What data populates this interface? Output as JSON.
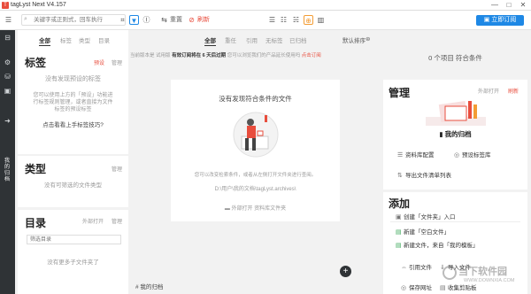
{
  "app": {
    "title": "tagLyst Next V4.157",
    "logo": "T"
  },
  "window_controls": [
    "—",
    "□",
    "✕"
  ],
  "toolbar": {
    "search_placeholder": "关键字或正则式，回车执行",
    "reset_label": "重置",
    "refresh_label": "刷新",
    "subscribe_label": "立即订阅"
  },
  "rail": {
    "vertical_text": "我的归档"
  },
  "tags_panel": {
    "tabs": [
      "全部",
      "标签",
      "类型",
      "目录"
    ],
    "title": "标签",
    "preset_label": "预设",
    "manage_label": "管理",
    "empty_title": "没有发现预设的标签",
    "desc_lines": [
      "您可以使用上方的「预设」功能进",
      "行标签规则管理，或者直接为文件",
      "标签的预设标签"
    ],
    "help_link": "点击看看上手标签技巧?"
  },
  "type_panel": {
    "title": "类型",
    "manage_label": "管理",
    "empty": "没有可筛选的文件类型"
  },
  "dir_panel": {
    "title": "目录",
    "open_label": "外部打开",
    "manage_label": "管理",
    "filter_placeholder": "筛选目录",
    "empty": "没有更多子文件夹了"
  },
  "center": {
    "tabs": [
      "全部",
      "重任",
      "引用",
      "无标签",
      "已归档"
    ],
    "sort_label": "默认排序",
    "notice_prefix": "当前版本是 试用版",
    "notice_bold": "有效订阅将在 6 天后过期",
    "notice_suffix": "您可以浏览我们的产品延长使用吗",
    "notice_link": "点击订阅",
    "empty_title": "没有发现符合条件的文件",
    "desc_lines": [
      "您可以改变检索条件，或者从左侧打开文件夹进行查阅。"
    ],
    "path": "D:\\用户\\我的文档\\tagLyst.archives\\",
    "open_label": "外部打开 资料库文件夹",
    "footer_label": "我的归档"
  },
  "right": {
    "count_label": "0 个项目 符合条件",
    "manage": {
      "title": "管理",
      "open_label": "外部打开",
      "refresh_label": "刷新",
      "archive_name": "我的归档",
      "items": [
        {
          "icon": "☰",
          "label": "资料库配置"
        },
        {
          "icon": "◎",
          "label": "预设标签库"
        },
        {
          "icon": "⇅",
          "label": "导出文件清单列表"
        }
      ]
    },
    "add": {
      "title": "添加",
      "items": [
        {
          "icon": "▣",
          "label": "创建「文件夹」入口",
          "red": true
        },
        {
          "icon": "▤",
          "label": "新建「空白文件」",
          "red": false
        },
        {
          "icon": "▤",
          "label": "新建文件，来自「我的模板」",
          "red": false
        }
      ],
      "pairs": [
        {
          "left": "引用文件",
          "right": "导入文件"
        },
        {
          "left": "保存网址",
          "right": "收集剪贴板"
        }
      ]
    }
  },
  "watermark": "当下软件园",
  "watermark_sub": "WWW.DOWNXIA.COM",
  "colors": {
    "accent": "#1e88e5",
    "red": "#e84d3d",
    "rail": "#2f3336"
  }
}
